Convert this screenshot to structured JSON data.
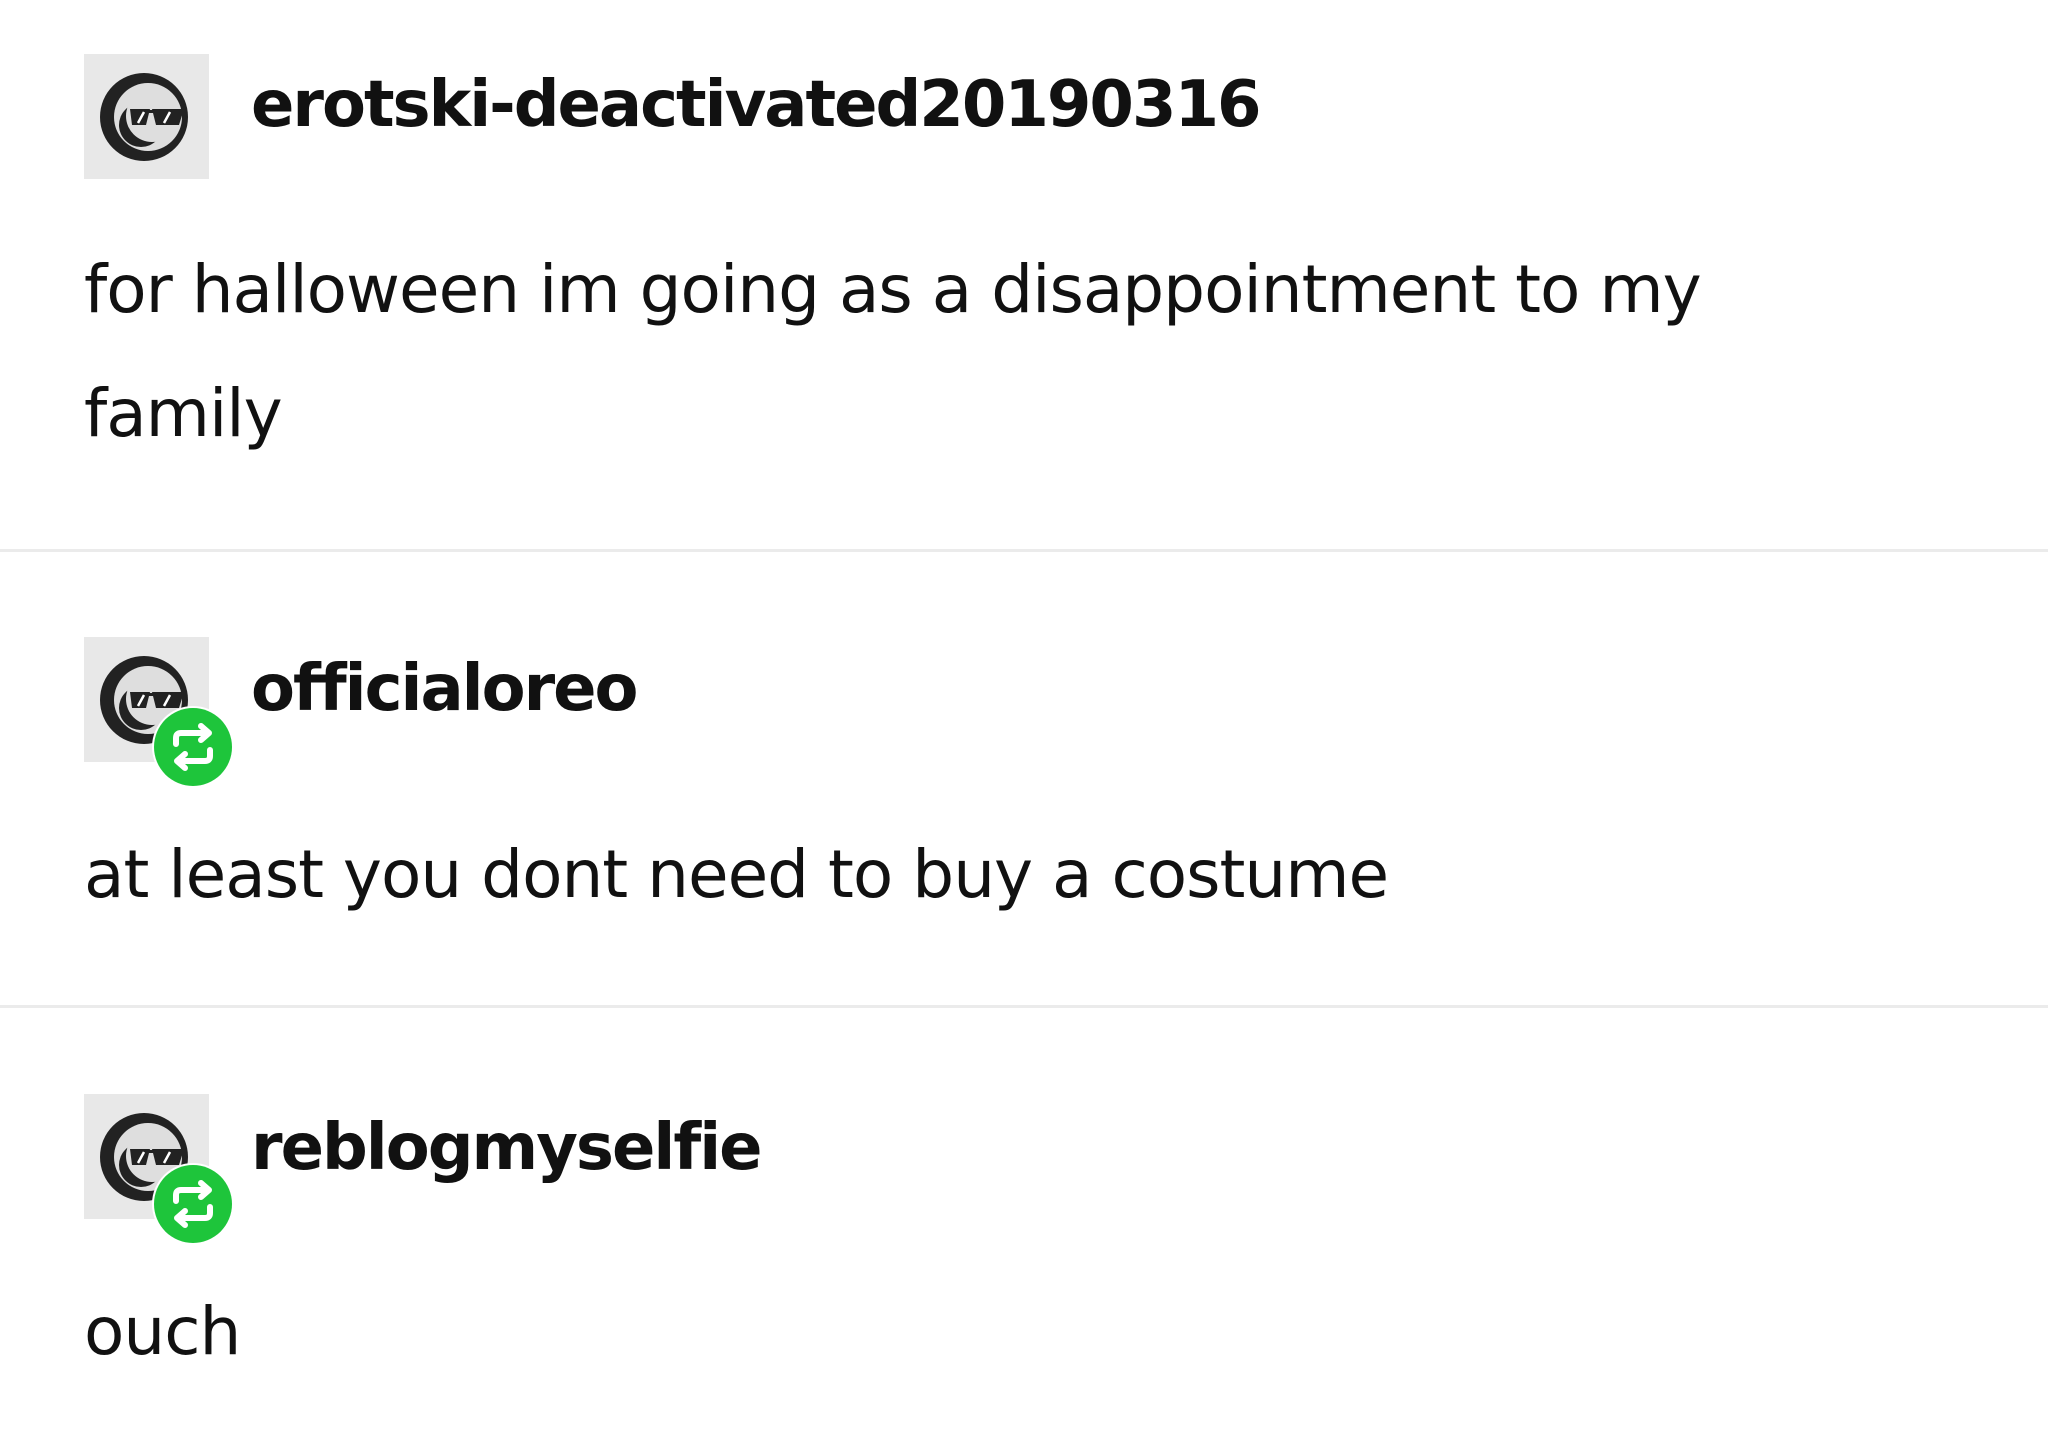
{
  "colors": {
    "background": "#ffffff",
    "text": "#111111",
    "divider": "#ebebeb",
    "avatar_background": "#e8e8e8",
    "reblog_badge": "#1ec53b"
  },
  "posts": [
    {
      "username": "erotski-deactivated20190316",
      "avatar_icon": "sunglasses-face-icon",
      "reblogged": false,
      "body_lines": [
        "for halloween im going as a disappointment to my",
        "family"
      ]
    },
    {
      "username": "officialoreo",
      "avatar_icon": "sunglasses-face-icon",
      "reblogged": true,
      "badge_icon": "reblog-icon",
      "body_lines": [
        "at least you dont need to buy a costume"
      ]
    },
    {
      "username": "reblogmyselfie",
      "avatar_icon": "sunglasses-face-icon",
      "reblogged": true,
      "badge_icon": "reblog-icon",
      "body_lines": [
        "ouch"
      ]
    }
  ]
}
